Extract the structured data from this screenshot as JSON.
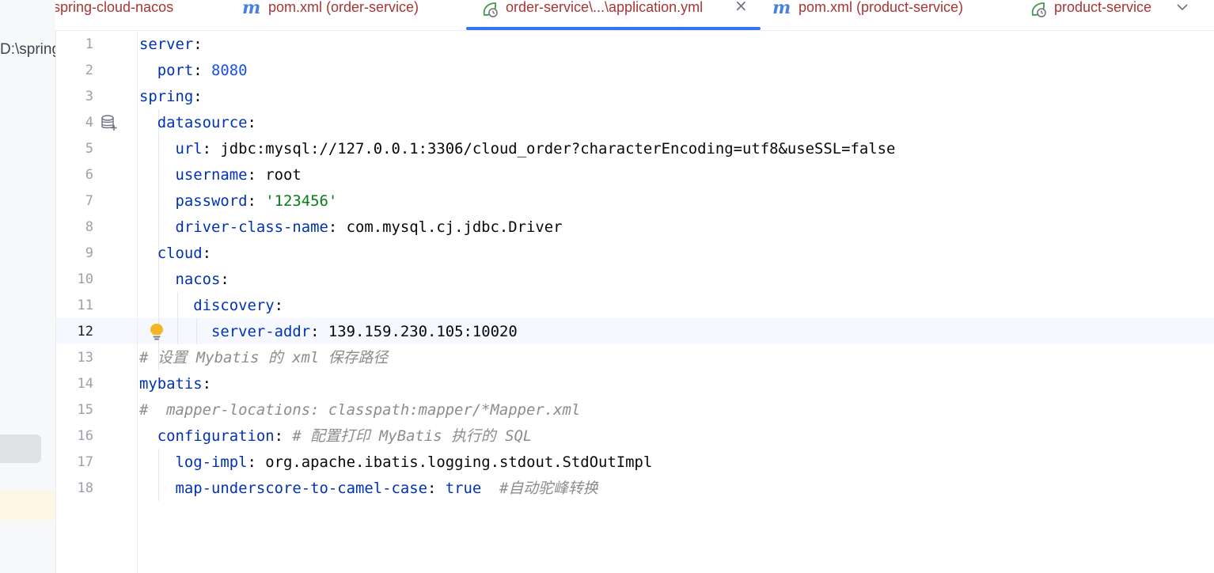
{
  "left_panel": {
    "path_fragment": "D:\\spring"
  },
  "tabs": [
    {
      "label": "spring-cloud-nacos",
      "icon": "none",
      "active": false
    },
    {
      "label": "pom.xml (order-service)",
      "icon": "maven-m-icon",
      "active": false
    },
    {
      "label": "order-service\\...\\application.yml",
      "icon": "spring-config-icon",
      "active": true
    },
    {
      "label": "pom.xml (product-service)",
      "icon": "maven-m-icon",
      "active": false
    },
    {
      "label": "product-service",
      "icon": "spring-config-icon",
      "active": false
    }
  ],
  "tab_icons": {
    "maven": "m",
    "close": "×"
  },
  "editor": {
    "current_line": 12,
    "lines": [
      {
        "n": "1",
        "segs": [
          {
            "t": "server",
            "c": "k"
          },
          {
            "t": ":",
            "c": ""
          }
        ]
      },
      {
        "n": "2",
        "segs": [
          {
            "t": "  ",
            "c": ""
          },
          {
            "t": "port",
            "c": "k"
          },
          {
            "t": ": ",
            "c": ""
          },
          {
            "t": "8080",
            "c": "n"
          }
        ]
      },
      {
        "n": "3",
        "segs": [
          {
            "t": "spring",
            "c": "k"
          },
          {
            "t": ":",
            "c": ""
          }
        ]
      },
      {
        "n": "4",
        "segs": [
          {
            "t": "  ",
            "c": ""
          },
          {
            "t": "datasource",
            "c": "k"
          },
          {
            "t": ":",
            "c": ""
          }
        ]
      },
      {
        "n": "5",
        "segs": [
          {
            "t": "    ",
            "c": ""
          },
          {
            "t": "url",
            "c": "k"
          },
          {
            "t": ": jdbc:mysql://127.0.0.1:3306/cloud_order?characterEncoding=utf8&useSSL=false",
            "c": ""
          }
        ]
      },
      {
        "n": "6",
        "segs": [
          {
            "t": "    ",
            "c": ""
          },
          {
            "t": "username",
            "c": "k"
          },
          {
            "t": ": root",
            "c": ""
          }
        ]
      },
      {
        "n": "7",
        "segs": [
          {
            "t": "    ",
            "c": ""
          },
          {
            "t": "password",
            "c": "k"
          },
          {
            "t": ": ",
            "c": ""
          },
          {
            "t": "'123456'",
            "c": "s"
          }
        ]
      },
      {
        "n": "8",
        "segs": [
          {
            "t": "    ",
            "c": ""
          },
          {
            "t": "driver-class-name",
            "c": "k"
          },
          {
            "t": ": com.mysql.cj.jdbc.Driver",
            "c": ""
          }
        ]
      },
      {
        "n": "9",
        "segs": [
          {
            "t": "  ",
            "c": ""
          },
          {
            "t": "cloud",
            "c": "k"
          },
          {
            "t": ":",
            "c": ""
          }
        ]
      },
      {
        "n": "10",
        "segs": [
          {
            "t": "    ",
            "c": ""
          },
          {
            "t": "nacos",
            "c": "k"
          },
          {
            "t": ":",
            "c": ""
          }
        ]
      },
      {
        "n": "11",
        "segs": [
          {
            "t": "      ",
            "c": ""
          },
          {
            "t": "discovery",
            "c": "k"
          },
          {
            "t": ":",
            "c": ""
          }
        ]
      },
      {
        "n": "12",
        "segs": [
          {
            "t": "        ",
            "c": ""
          },
          {
            "t": "server-addr",
            "c": "k"
          },
          {
            "t": ": 139.159.230.105:10020",
            "c": ""
          }
        ]
      },
      {
        "n": "13",
        "segs": [
          {
            "t": "# 设置 Mybatis 的 xml 保存路径",
            "c": "c"
          }
        ]
      },
      {
        "n": "14",
        "segs": [
          {
            "t": "mybatis",
            "c": "k"
          },
          {
            "t": ":",
            "c": ""
          }
        ]
      },
      {
        "n": "15",
        "segs": [
          {
            "t": "#  mapper-locations: classpath:mapper/*Mapper.xml",
            "c": "c"
          }
        ]
      },
      {
        "n": "16",
        "segs": [
          {
            "t": "  ",
            "c": ""
          },
          {
            "t": "configuration",
            "c": "k"
          },
          {
            "t": ": ",
            "c": ""
          },
          {
            "t": "# 配置打印 MyBatis 执行的 SQL",
            "c": "c"
          }
        ]
      },
      {
        "n": "17",
        "segs": [
          {
            "t": "    ",
            "c": ""
          },
          {
            "t": "log-impl",
            "c": "k"
          },
          {
            "t": ": org.apache.ibatis.logging.stdout.StdOutImpl",
            "c": ""
          }
        ]
      },
      {
        "n": "18",
        "segs": [
          {
            "t": "    ",
            "c": ""
          },
          {
            "t": "map-underscore-to-camel-case",
            "c": "k"
          },
          {
            "t": ": ",
            "c": ""
          },
          {
            "t": "true",
            "c": "k"
          },
          {
            "t": "  ",
            "c": ""
          },
          {
            "t": "#自动驼峰转换",
            "c": "c"
          }
        ]
      }
    ]
  },
  "colors": {
    "key": "#0033b3",
    "number": "#1750eb",
    "string": "#067d17",
    "comment": "#8c8c8c",
    "active_tab_underline": "#3574f0",
    "caret_row": "#f5f8fe"
  }
}
